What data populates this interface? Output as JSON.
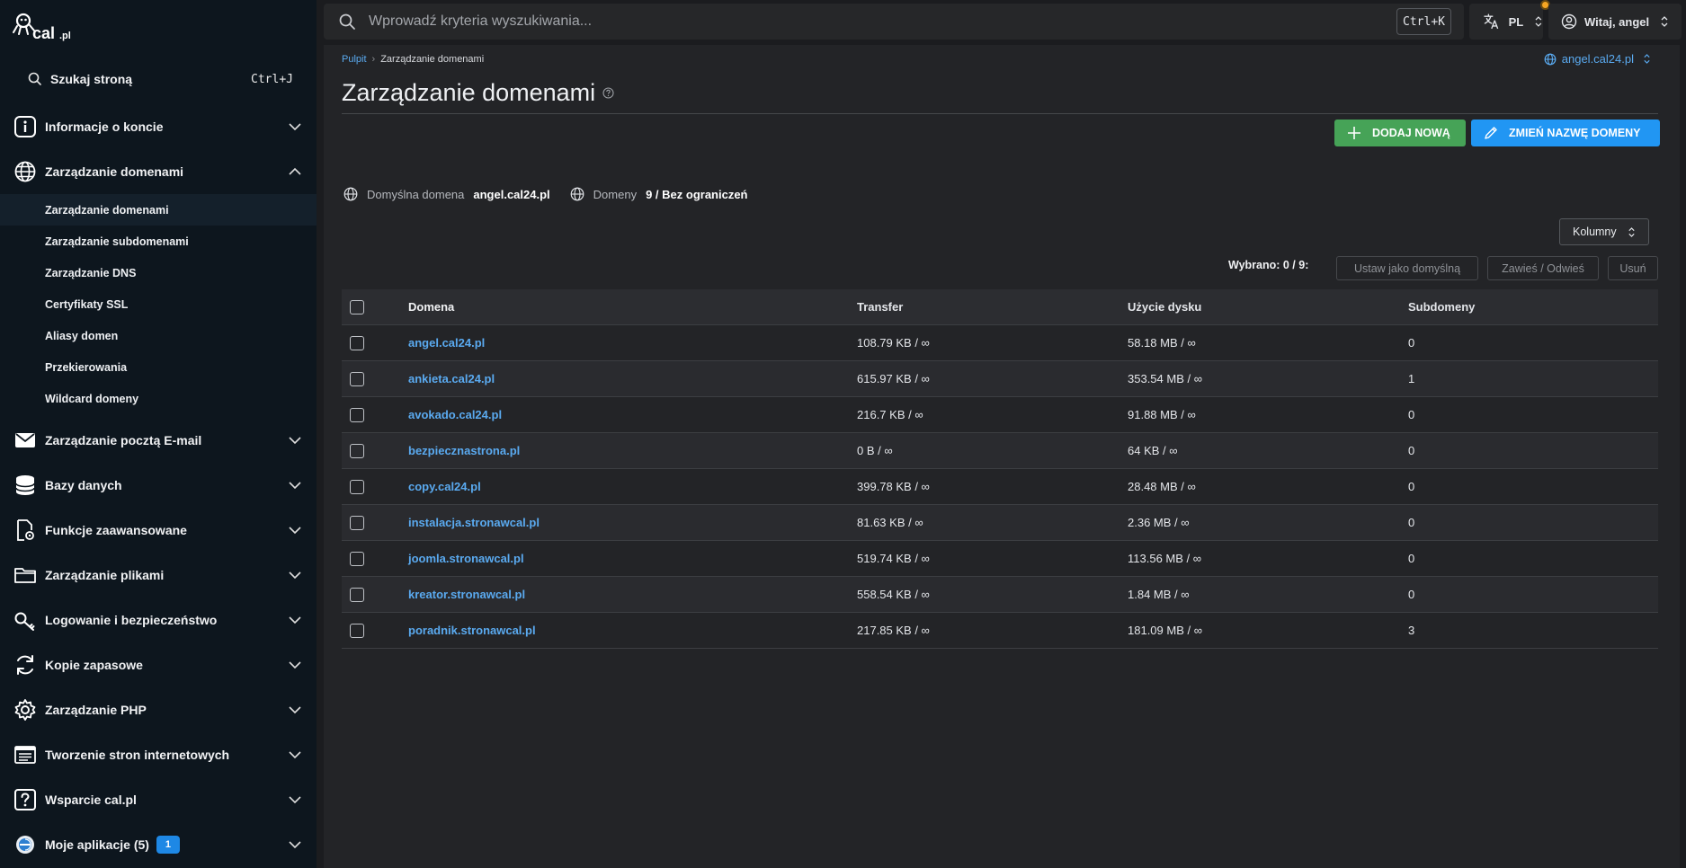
{
  "brand": {
    "logo_text": "cal.pl"
  },
  "sidebar": {
    "search": {
      "label": "Szukaj stroną",
      "shortcut": "Ctrl+J"
    },
    "items": [
      {
        "label": "Informacje o koncie",
        "icon": "info-icon"
      },
      {
        "label": "Zarządzanie domenami",
        "icon": "globe-icon",
        "expanded": true
      },
      {
        "label": "Zarządzanie pocztą E-mail",
        "icon": "mail-icon"
      },
      {
        "label": "Bazy danych",
        "icon": "database-icon"
      },
      {
        "label": "Funkcje zaawansowane",
        "icon": "advanced-file-icon"
      },
      {
        "label": "Zarządzanie plikami",
        "icon": "folder-icon"
      },
      {
        "label": "Logowanie i bezpieczeństwo",
        "icon": "key-icon"
      },
      {
        "label": "Kopie zapasowe",
        "icon": "refresh-icon"
      },
      {
        "label": "Zarządzanie PHP",
        "icon": "gear-icon"
      },
      {
        "label": "Tworzenie stron internetowych",
        "icon": "browser-icon"
      },
      {
        "label": "Wsparcie cal.pl",
        "icon": "question-icon"
      },
      {
        "label": "Moje aplikacje (5)",
        "icon": "app-icon",
        "badge": "1"
      }
    ],
    "submenu": [
      {
        "label": "Zarządzanie domenami",
        "active": true
      },
      {
        "label": "Zarządzanie subdomenami"
      },
      {
        "label": "Zarządzanie DNS"
      },
      {
        "label": "Certyfikaty SSL"
      },
      {
        "label": "Aliasy domen"
      },
      {
        "label": "Przekierowania"
      },
      {
        "label": "Wildcard domeny"
      }
    ]
  },
  "topbar": {
    "search_placeholder": "Wprowadź kryteria wyszukiwania...",
    "search_shortcut": "Ctrl+K",
    "language": "PL",
    "greeting": "Witaj, angel"
  },
  "breadcrumb": {
    "root": "Pulpit",
    "current": "Zarządzanie domenami"
  },
  "domain_selector": "angel.cal24.pl",
  "page": {
    "title": "Zarządzanie domenami",
    "add_button": "DODAJ NOWĄ",
    "rename_button": "ZMIEŃ NAZWĘ DOMENY",
    "default_domain_label": "Domyślna domena",
    "default_domain_value": "angel.cal24.pl",
    "domains_label": "Domeny",
    "domains_value": "9 / Bez ograniczeń",
    "columns_button": "Kolumny",
    "selected": "Wybrano: 0 / 9:",
    "set_default": "Ustaw jako domyślną",
    "suspend": "Zawieś / Odwieś",
    "delete": "Usuń"
  },
  "table": {
    "headers": {
      "domain": "Domena",
      "transfer": "Transfer",
      "disk": "Użycie dysku",
      "subdomains": "Subdomeny"
    },
    "rows": [
      {
        "domain": "angel.cal24.pl",
        "transfer": "108.79 KB / ∞",
        "disk": "58.18 MB / ∞",
        "subdomains": "0"
      },
      {
        "domain": "ankieta.cal24.pl",
        "transfer": "615.97 KB / ∞",
        "disk": "353.54 MB / ∞",
        "subdomains": "1"
      },
      {
        "domain": "avokado.cal24.pl",
        "transfer": "216.7 KB / ∞",
        "disk": "91.88 MB / ∞",
        "subdomains": "0"
      },
      {
        "domain": "bezpiecznastrona.pl",
        "transfer": "0 B / ∞",
        "disk": "64 KB / ∞",
        "subdomains": "0"
      },
      {
        "domain": "copy.cal24.pl",
        "transfer": "399.78 KB / ∞",
        "disk": "28.48 MB / ∞",
        "subdomains": "0"
      },
      {
        "domain": "instalacja.stronawcal.pl",
        "transfer": "81.63 KB / ∞",
        "disk": "2.36 MB / ∞",
        "subdomains": "0"
      },
      {
        "domain": "joomla.stronawcal.pl",
        "transfer": "519.74 KB / ∞",
        "disk": "113.56 MB / ∞",
        "subdomains": "0"
      },
      {
        "domain": "kreator.stronawcal.pl",
        "transfer": "558.54 KB / ∞",
        "disk": "1.84 MB / ∞",
        "subdomains": "0"
      },
      {
        "domain": "poradnik.stronawcal.pl",
        "transfer": "217.85 KB / ∞",
        "disk": "181.09 MB / ∞",
        "subdomains": "3"
      }
    ]
  },
  "colors": {
    "accent": "#2196f3",
    "success": "#46a357",
    "link": "#5aaaf0",
    "sidebar_bg": "#0d161e",
    "panel_bg": "#232427"
  }
}
